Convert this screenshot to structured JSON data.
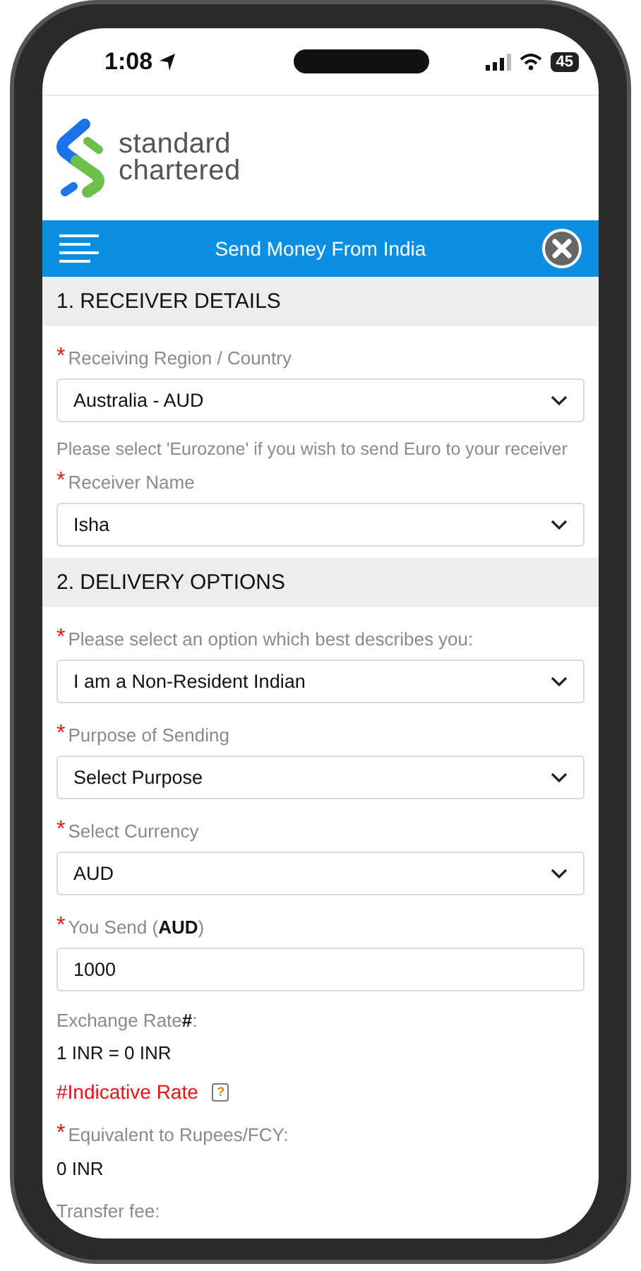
{
  "status_bar": {
    "time": "1:08",
    "battery": "45"
  },
  "brand": {
    "line_1": "standard",
    "line_2": "chartered"
  },
  "nav": {
    "title": "Send Money From India"
  },
  "sections": [
    {
      "title": "1. RECEIVER DETAILS",
      "fields": [
        {
          "kind": "select",
          "marker": "*",
          "label": "Receiving Region / Country",
          "value": "Australia - AUD"
        },
        {
          "kind": "note",
          "text": "Please select 'Eurozone' if you wish to send Euro to your receiver"
        },
        {
          "kind": "select",
          "marker": "*",
          "label": "Receiver Name",
          "value": "Isha"
        }
      ]
    },
    {
      "title": "2. DELIVERY OPTIONS",
      "fields": [
        {
          "kind": "select",
          "marker": "*",
          "label": "Please select an option which best describes you:",
          "value": "I am a Non-Resident Indian"
        },
        {
          "kind": "select",
          "marker": "*",
          "label": "Purpose of Sending",
          "value": "Select Purpose"
        },
        {
          "kind": "select",
          "marker": "*",
          "label": "Select Currency",
          "value": "AUD"
        },
        {
          "kind": "input",
          "marker": "*",
          "label": "You Send (**AUD**)",
          "value": "1000"
        },
        {
          "kind": "info",
          "label": "Exchange Rate**#**:",
          "value": "1 INR = 0 INR"
        },
        {
          "kind": "alert",
          "text": "#Indicative Rate",
          "help": "?"
        },
        {
          "kind": "info",
          "marker": "*",
          "label": "Equivalent to Rupees/FCY:",
          "value": "0 INR"
        },
        {
          "kind": "info",
          "label": "Transfer fee:"
        }
      ]
    }
  ]
}
